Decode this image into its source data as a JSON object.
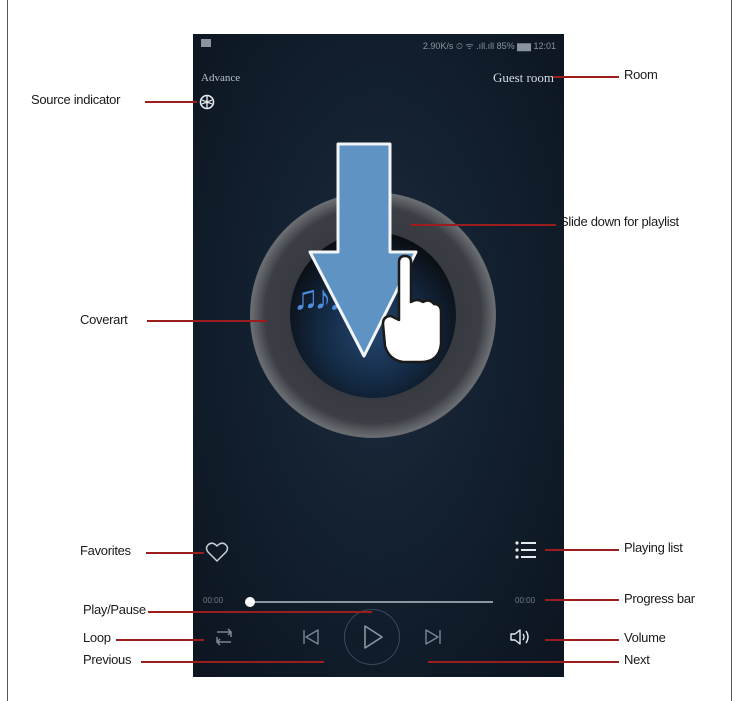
{
  "status_bar": {
    "text": "2.90K/s ⏲ ᯤ .ıll.ıll 85% ▆▆ 12:01"
  },
  "header": {
    "source_label": "Advance",
    "room_name": "Guest room"
  },
  "player": {
    "time_elapsed": "00:00",
    "time_total": "00:00",
    "progress": 0.0
  },
  "annotations": {
    "room": "Room",
    "source_indicator": "Source indicator",
    "slide_down": "Slide down for playlist",
    "coverart": "Coverart",
    "favorites": "Favorites",
    "playing_list": "Playing list",
    "progress_bar": "Progress bar",
    "play_pause": "Play/Pause",
    "loop": "Loop",
    "volume": "Volume",
    "previous": "Previous",
    "next": "Next"
  },
  "colors": {
    "leader": "#9b1d1d",
    "arrow": "#5f93c3",
    "accent_notes": "#4c8de0"
  },
  "icons": [
    "source-icon",
    "heart-icon",
    "playlist-icon",
    "loop-icon",
    "previous-icon",
    "play-icon",
    "next-icon",
    "volume-icon"
  ]
}
